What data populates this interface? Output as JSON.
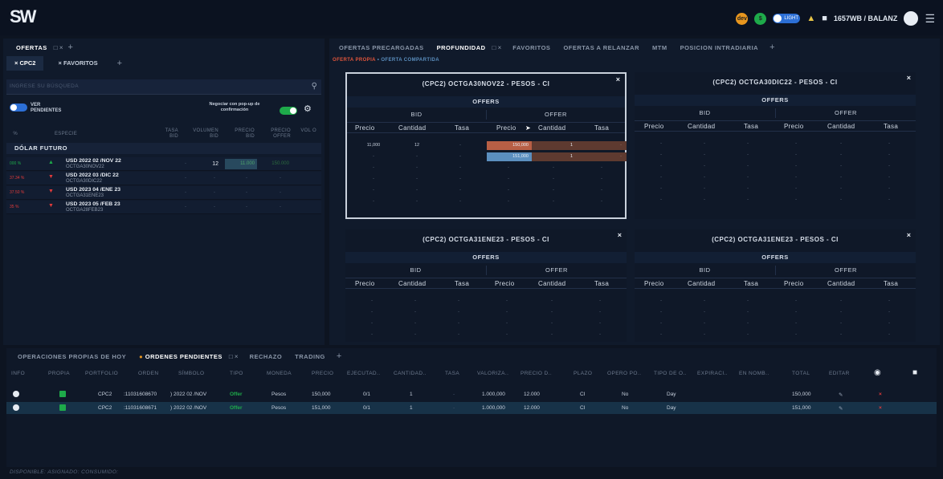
{
  "topbar": {
    "logo": "SW",
    "badge1": "dev",
    "badge2": "$",
    "toggle_label": "LIGHT",
    "account": "1657WB / BALANZ"
  },
  "left": {
    "tabs": [
      {
        "label": "OFERTAS"
      }
    ],
    "subtabs": [
      "CPC2",
      "FAVORITOS"
    ],
    "search_placeholder": "INGRESE SU BÚSQUEDA",
    "ver_label": "VER",
    "pendientes_label": "PENDIENTES",
    "popup_label": "Negociar con pop-up de confirmación",
    "columns": [
      "%",
      "ESPECIE",
      "TASA BID",
      "VOLUMEN BID",
      "PRECIO BID",
      "PRECIO OFFER",
      "VOL O"
    ],
    "section": "DÓLAR FUTURO",
    "rows": [
      {
        "pct": "000 %",
        "name": "USD 2022 02 /NOV 22",
        "code": "OCTGA30NOV22",
        "vol_bid": "12",
        "bid": "11.000",
        "offer": "150.000",
        "dir": "up"
      },
      {
        "pct": "37.34 %",
        "name": "USD 2022 03 /DIC 22",
        "code": "OCTGA30DIC22",
        "vol_bid": "-",
        "bid": "-",
        "offer": "-",
        "dir": "down"
      },
      {
        "pct": "37.50 %",
        "name": "USD 2023 04 /ENE 23",
        "code": "OCTGA31ENE23",
        "vol_bid": "-",
        "bid": "-",
        "offer": "-",
        "dir": "down"
      },
      {
        "pct": "35 %",
        "name": "USD 2023 05 /FEB 23",
        "code": "OCTGA28FEB23",
        "vol_bid": "-",
        "bid": "-",
        "offer": "-",
        "dir": "down"
      }
    ]
  },
  "right": {
    "tabs": [
      "OFERTAS PRECARGADAS",
      "PROFUNDIDAD",
      "FAVORITOS",
      "OFERTAS A RELANZAR",
      "MTM",
      "POSICION INTRADIARIA"
    ],
    "legend_propia": "OFERTA PROPIA",
    "legend_compartida": "OFERTA COMPARTIDA",
    "offers_label": "OFFERS",
    "bid_label": "BID",
    "offer_label": "OFFER",
    "cols": [
      "Precio",
      "Cantidad",
      "Tasa",
      "Precio",
      "Cantidad",
      "Tasa"
    ],
    "cards": [
      {
        "title": "(CPC2) OCTGA30NOV22 - PESOS - CI",
        "close": "×",
        "rows": [
          [
            "11,000",
            "12",
            "-",
            "150,000",
            "1",
            "-"
          ],
          [
            "-",
            "-",
            "-",
            "151,000",
            "1",
            "-"
          ],
          [
            "-",
            "-",
            "-",
            "-",
            "-",
            "-"
          ],
          [
            "-",
            "-",
            "-",
            "-",
            "-",
            "-"
          ],
          [
            "-",
            "-",
            "-",
            "-",
            "-",
            "-"
          ],
          [
            "-",
            "-",
            "-",
            "-",
            "-",
            "-"
          ]
        ]
      },
      {
        "title": "(CPC2) OCTGA30DIC22 - PESOS - CI",
        "close": "×",
        "rows": [
          [
            "-",
            "-",
            "-",
            "-",
            "-",
            "-"
          ],
          [
            "-",
            "-",
            "-",
            "-",
            "-",
            "-"
          ],
          [
            "-",
            "-",
            "-",
            "-",
            "-",
            "-"
          ],
          [
            "-",
            "-",
            "-",
            "-",
            "-",
            "-"
          ],
          [
            "-",
            "-",
            "-",
            "-",
            "-",
            "-"
          ],
          [
            "-",
            "-",
            "-",
            "-",
            "-",
            "-"
          ]
        ]
      },
      {
        "title": "(CPC2) OCTGA31ENE23 - PESOS - CI",
        "close": "×",
        "rows": [
          [
            "-",
            "-",
            "-",
            "-",
            "-",
            "-"
          ],
          [
            "-",
            "-",
            "-",
            "-",
            "-",
            "-"
          ],
          [
            "-",
            "-",
            "-",
            "-",
            "-",
            "-"
          ],
          [
            "-",
            "-",
            "-",
            "-",
            "-",
            "-"
          ]
        ]
      },
      {
        "title": "(CPC2) OCTGA31ENE23 - PESOS - CI",
        "close": "×",
        "rows": [
          [
            "-",
            "-",
            "-",
            "-",
            "-",
            "-"
          ],
          [
            "-",
            "-",
            "-",
            "-",
            "-",
            "-"
          ],
          [
            "-",
            "-",
            "-",
            "-",
            "-",
            "-"
          ],
          [
            "-",
            "-",
            "-",
            "-",
            "-",
            "-"
          ]
        ]
      }
    ]
  },
  "bottom": {
    "tabs": [
      "OPERACIONES PROPIAS DE HOY",
      "ORDENES PENDIENTES",
      "RECHAZO",
      "TRADING"
    ],
    "columns": [
      "INFO",
      "PROPIA",
      "PORTFOLIO",
      "ORDEN",
      "SÍMBOLO",
      "TIPO",
      "MONEDA",
      "PRECIO",
      "EJECUTAD..",
      "CANTIDAD..",
      "TASA",
      "VALORIZA..",
      "PRECIO D..",
      "PLAZO",
      "OPERO PO..",
      "TIPO DE O..",
      "EXPIRACI..",
      "EN NOMB..",
      "TOTAL",
      "EDITAR"
    ],
    "rows": [
      {
        "portfolio": "CPC2",
        "orden": ":11031608670",
        "simbolo": ") 2022 02 /NOV",
        "tipo": "Offer",
        "moneda": "Pesos",
        "precio": "150,000",
        "ejecutado": "0/1",
        "cantidad": "1",
        "tasa": "-",
        "valorizado": "1.000,000",
        "precio_d": "12.000",
        "plazo": "CI",
        "opero": "No",
        "tipo_o": "Day",
        "total": "150,000",
        "selected": false
      },
      {
        "portfolio": "CPC2",
        "orden": ":11031608671",
        "simbolo": ") 2022 02 /NOV",
        "tipo": "Offer",
        "moneda": "Pesos",
        "precio": "151,000",
        "ejecutado": "0/1",
        "cantidad": "1",
        "tasa": "-",
        "valorizado": "1.000,000",
        "precio_d": "12.000",
        "plazo": "CI",
        "opero": "No",
        "tipo_o": "Day",
        "total": "151,000",
        "selected": true
      }
    ]
  },
  "footer": {
    "disponible": "DISPONIBLE:",
    "asignado": "ASIGNADO:",
    "consumido": "CONSUMIDO:"
  },
  "colors": {
    "accent": "#2c6fd6",
    "positive": "#1eaa4a",
    "negative": "#e23b3b",
    "offer_bar": "#b85f45",
    "offer_bar2": "#5b8fbf"
  }
}
